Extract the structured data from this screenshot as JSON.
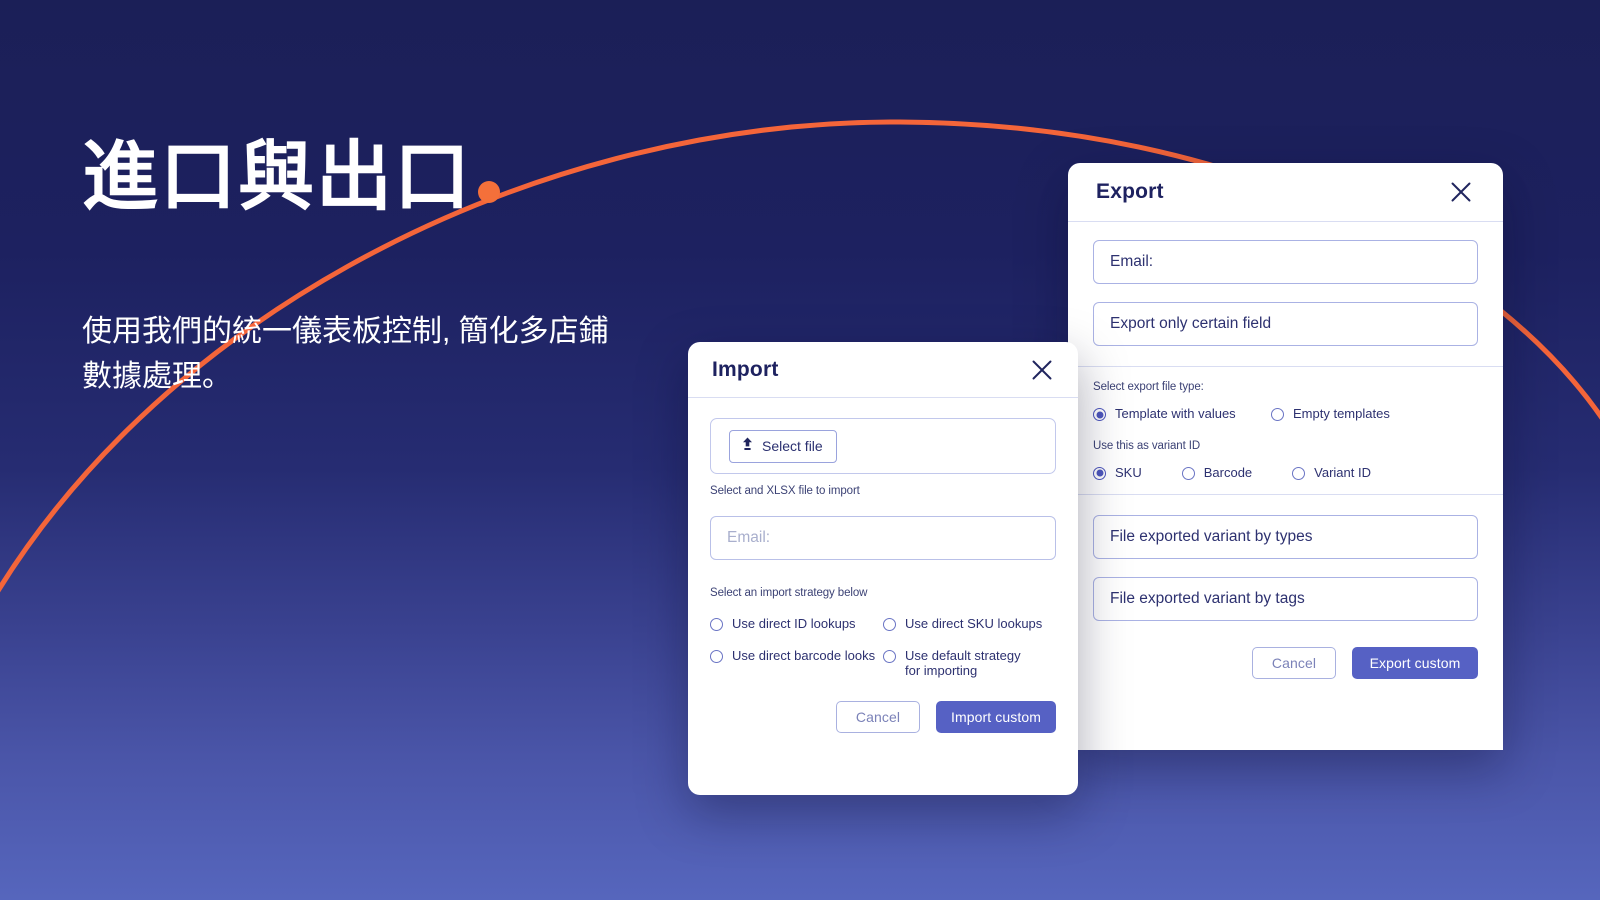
{
  "page": {
    "background_top_color": "#1b1f57",
    "background_bottom_color": "#5666bd",
    "accent_orange": "#f4703a",
    "accent_indigo": "#5661c4"
  },
  "hero": {
    "title": "進口與出口",
    "title_dot": "•",
    "subtitle": "使用我們的統一儀表板控制, 簡化多店鋪數據處理。"
  },
  "import_dialog": {
    "title": "Import",
    "close_icon": "close-icon",
    "select_file": {
      "label": "Select file",
      "icon": "upload-icon"
    },
    "file_hint": "Select and XLSX file to import",
    "email_field": {
      "value": "",
      "placeholder": "Email:"
    },
    "strategy_hint": "Select an import strategy below",
    "strategy_options": [
      {
        "label": "Use direct ID lookups",
        "checked": false
      },
      {
        "label": "Use direct SKU lookups",
        "checked": false
      },
      {
        "label": "Use direct barcode looks",
        "checked": false
      },
      {
        "label": "Use default strategy for importing",
        "checked": false
      }
    ],
    "cancel_label": "Cancel",
    "submit_label": "Import custom"
  },
  "export_dialog": {
    "title": "Export",
    "close_icon": "close-icon",
    "email_field": {
      "value": "Email:",
      "placeholder": "Email:"
    },
    "certain_field": {
      "value": "Export only certain field",
      "placeholder": "Export only certain field"
    },
    "file_type_hint": "Select export file type:",
    "file_type_options": [
      {
        "label": "Template with values",
        "checked": true
      },
      {
        "label": "Empty templates",
        "checked": false
      }
    ],
    "variant_hint": "Use this as variant ID",
    "variant_options": [
      {
        "label": "SKU",
        "checked": true
      },
      {
        "label": "Barcode",
        "checked": false
      },
      {
        "label": "Variant ID",
        "checked": false
      }
    ],
    "variant_types_field": {
      "value": "File exported variant by types",
      "placeholder": "File exported variant by types"
    },
    "variant_tags_field": {
      "value": "File exported variant by tags",
      "placeholder": "File exported variant by tags"
    },
    "cancel_label": "Cancel",
    "submit_label": "Export custom"
  }
}
